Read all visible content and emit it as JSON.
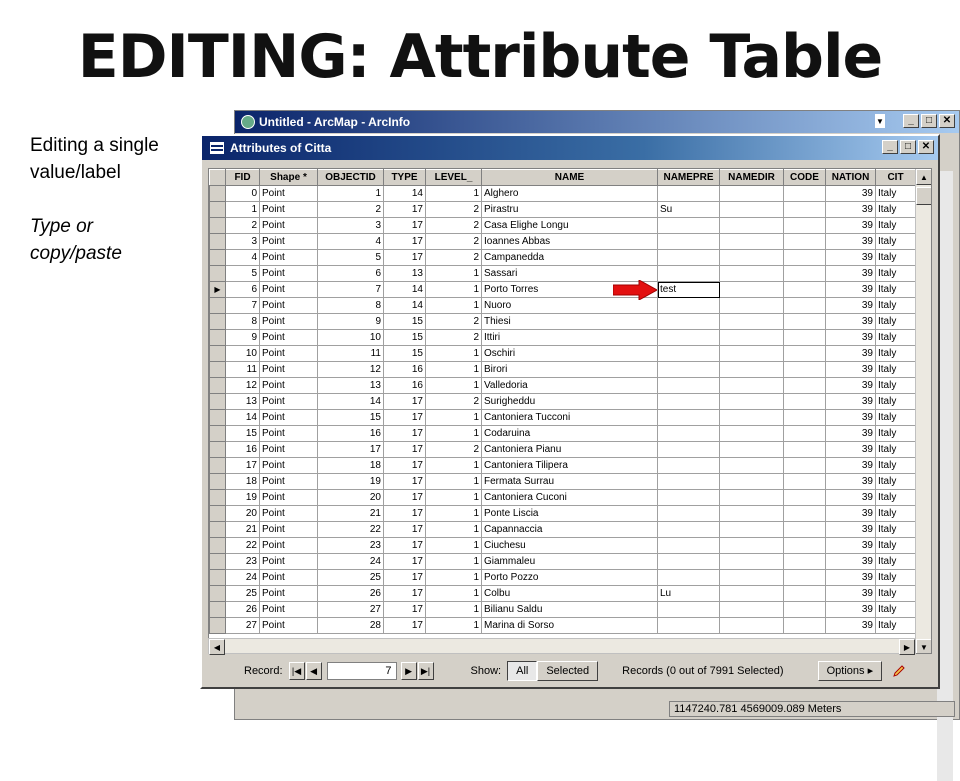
{
  "slide": {
    "title": "EDITING: Attribute Table",
    "side_line1": "Editing a single value/label",
    "side_line2": "Type or copy/paste"
  },
  "arcmap": {
    "title": "Untitled - ArcMap - ArcInfo",
    "status": "1147240.781  4569009.089 Meters"
  },
  "attr_window": {
    "title": "Attributes of Citta"
  },
  "table": {
    "columns": [
      "FID",
      "Shape *",
      "OBJECTID",
      "TYPE",
      "LEVEL_",
      "NAME",
      "NAMEPRE",
      "NAMEDIR",
      "CODE",
      "NATION",
      "CIT"
    ],
    "rows": [
      [
        "0",
        "Point",
        "1",
        "14",
        "1",
        "Alghero",
        "",
        "",
        "",
        "39",
        "Italy"
      ],
      [
        "1",
        "Point",
        "2",
        "17",
        "2",
        "Pirastru",
        "Su",
        "",
        "",
        "39",
        "Italy"
      ],
      [
        "2",
        "Point",
        "3",
        "17",
        "2",
        "Casa Elighe Longu",
        "",
        "",
        "",
        "39",
        "Italy"
      ],
      [
        "3",
        "Point",
        "4",
        "17",
        "2",
        "Ioannes Abbas",
        "",
        "",
        "",
        "39",
        "Italy"
      ],
      [
        "4",
        "Point",
        "5",
        "17",
        "2",
        "Campanedda",
        "",
        "",
        "",
        "39",
        "Italy"
      ],
      [
        "5",
        "Point",
        "6",
        "13",
        "1",
        "Sassari",
        "",
        "",
        "",
        "39",
        "Italy"
      ],
      [
        "6",
        "Point",
        "7",
        "14",
        "1",
        "Porto Torres",
        "test",
        "",
        "",
        "39",
        "Italy"
      ],
      [
        "7",
        "Point",
        "8",
        "14",
        "1",
        "Nuoro",
        "",
        "",
        "",
        "39",
        "Italy"
      ],
      [
        "8",
        "Point",
        "9",
        "15",
        "2",
        "Thiesi",
        "",
        "",
        "",
        "39",
        "Italy"
      ],
      [
        "9",
        "Point",
        "10",
        "15",
        "2",
        "Ittiri",
        "",
        "",
        "",
        "39",
        "Italy"
      ],
      [
        "10",
        "Point",
        "11",
        "15",
        "1",
        "Oschiri",
        "",
        "",
        "",
        "39",
        "Italy"
      ],
      [
        "11",
        "Point",
        "12",
        "16",
        "1",
        "Birori",
        "",
        "",
        "",
        "39",
        "Italy"
      ],
      [
        "12",
        "Point",
        "13",
        "16",
        "1",
        "Valledoria",
        "",
        "",
        "",
        "39",
        "Italy"
      ],
      [
        "13",
        "Point",
        "14",
        "17",
        "2",
        "Surigheddu",
        "",
        "",
        "",
        "39",
        "Italy"
      ],
      [
        "14",
        "Point",
        "15",
        "17",
        "1",
        "Cantoniera Tucconi",
        "",
        "",
        "",
        "39",
        "Italy"
      ],
      [
        "15",
        "Point",
        "16",
        "17",
        "1",
        "Codaruina",
        "",
        "",
        "",
        "39",
        "Italy"
      ],
      [
        "16",
        "Point",
        "17",
        "17",
        "2",
        "Cantoniera Pianu",
        "",
        "",
        "",
        "39",
        "Italy"
      ],
      [
        "17",
        "Point",
        "18",
        "17",
        "1",
        "Cantoniera Tilipera",
        "",
        "",
        "",
        "39",
        "Italy"
      ],
      [
        "18",
        "Point",
        "19",
        "17",
        "1",
        "Fermata Surrau",
        "",
        "",
        "",
        "39",
        "Italy"
      ],
      [
        "19",
        "Point",
        "20",
        "17",
        "1",
        "Cantoniera Cuconi",
        "",
        "",
        "",
        "39",
        "Italy"
      ],
      [
        "20",
        "Point",
        "21",
        "17",
        "1",
        "Ponte Liscia",
        "",
        "",
        "",
        "39",
        "Italy"
      ],
      [
        "21",
        "Point",
        "22",
        "17",
        "1",
        "Capannaccia",
        "",
        "",
        "",
        "39",
        "Italy"
      ],
      [
        "22",
        "Point",
        "23",
        "17",
        "1",
        "Ciuchesu",
        "",
        "",
        "",
        "39",
        "Italy"
      ],
      [
        "23",
        "Point",
        "24",
        "17",
        "1",
        "Giammaleu",
        "",
        "",
        "",
        "39",
        "Italy"
      ],
      [
        "24",
        "Point",
        "25",
        "17",
        "1",
        "Porto Pozzo",
        "",
        "",
        "",
        "39",
        "Italy"
      ],
      [
        "25",
        "Point",
        "26",
        "17",
        "1",
        "Colbu",
        "Lu",
        "",
        "",
        "39",
        "Italy"
      ],
      [
        "26",
        "Point",
        "27",
        "17",
        "1",
        "Bilianu Saldu",
        "",
        "",
        "",
        "39",
        "Italy"
      ],
      [
        "27",
        "Point",
        "28",
        "17",
        "1",
        "Marina di Sorso",
        "",
        "",
        "",
        "39",
        "Italy"
      ]
    ],
    "current_row_index": 6,
    "editing_col_index": 6
  },
  "footer": {
    "record_label": "Record:",
    "record_value": "7",
    "show_label": "Show:",
    "all_label": "All",
    "selected_label": "Selected",
    "records_status": "Records (0 out of 7991 Selected)",
    "options_label": "Options"
  },
  "colors": {
    "title_bar": "#0a246a",
    "arrow": "#e31010"
  }
}
